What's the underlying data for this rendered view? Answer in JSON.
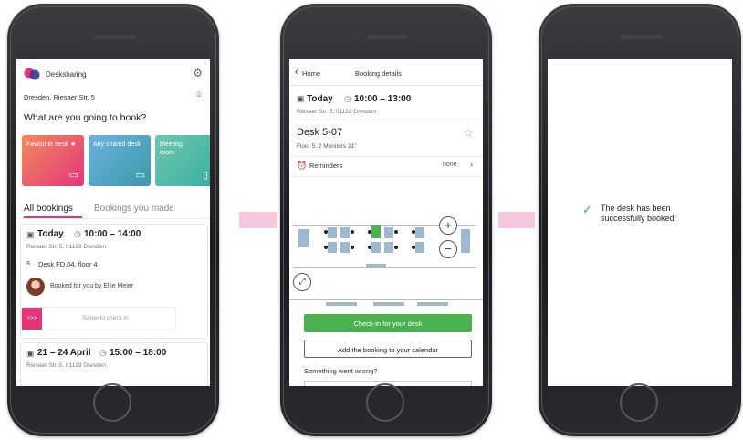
{
  "screen1": {
    "app_title": "Desksharing",
    "location": "Dresden, Riesaer Str. 5",
    "question": "What are you going to book?",
    "tiles": [
      {
        "label": "Favourite desk ★",
        "color": "#f06a6a"
      },
      {
        "label": "Any shared desk",
        "color": "#4db6ac"
      },
      {
        "label": "Meeting room",
        "color": "#4db6ac"
      }
    ],
    "tabs": {
      "active": "All bookings",
      "inactive": "Bookings you made"
    },
    "booking1": {
      "date": "Today",
      "time": "10:00 – 14:00",
      "address": "Riesaer Str. 5, 01129 Dresden",
      "desk": "Desk FD.04, floor 4",
      "booked_by": "Booked for you by Ellie Meier",
      "swipe_label": "Swipe to check in",
      "swipe_handle": ">>>"
    },
    "booking2": {
      "date": "21 – 24 April",
      "time": "15:00 – 18:00",
      "address": "Riesaer Str. 5, 01129 Dresden"
    }
  },
  "screen2": {
    "back_label": "Home",
    "title": "Booking details",
    "date": "Today",
    "time": "10:00 – 13:00",
    "address": "Riesaer Str. 5, 01129 Dresden",
    "desk": "Desk 5-07",
    "desk_details": "Floor 5, 2 Monitors 21\"",
    "reminders_label": "Reminders",
    "reminders_value": "none",
    "zoom_in": "+",
    "zoom_out": "−",
    "checkin_button": "Check-in for your desk",
    "calendar_button": "Add the booking to your calendar",
    "help_text": "Something went wrong?"
  },
  "screen3": {
    "message": "The desk has been successfully booked!",
    "check": "✓"
  },
  "colors": {
    "accent_pink": "#e5357a",
    "teal": "#4db6ac",
    "coral": "#f06a6a",
    "green": "#4caf50",
    "desk_selected": "#4caf50"
  }
}
